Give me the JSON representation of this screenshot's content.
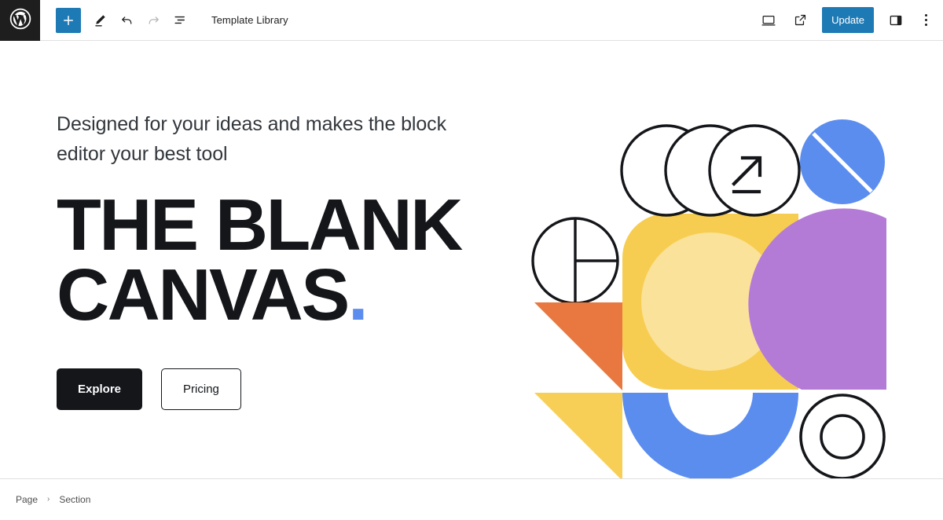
{
  "window": {
    "app": "WordPress Block Editor"
  },
  "toolbar": {
    "logo_icon": "wordpress-logo-icon",
    "add_block_label": "+",
    "add_block_icon": "plus-icon",
    "tools_icon": "pencil-edit-icon",
    "undo_icon": "undo-arrow-icon",
    "redo_icon": "redo-arrow-icon",
    "list_view_icon": "list-view-icon",
    "document_title": "Template Library",
    "preview_icon": "desktop-device-icon",
    "view_site_icon": "external-link-icon",
    "update_label": "Update",
    "settings_sidebar_icon": "sidebar-panel-icon",
    "options_icon": "kebab-vertical-dots-icon",
    "accent_color": "#1e7ab5"
  },
  "hero": {
    "subtitle": "Designed for your ideas and makes the block editor your best tool",
    "title_line1": "THE BLANK",
    "title_line2": "CANVAS",
    "title_dot": ".",
    "dot_color": "#5b8def",
    "buttons": [
      {
        "label": "Explore",
        "style": "primary"
      },
      {
        "label": "Pricing",
        "style": "secondary"
      }
    ]
  },
  "artwork": {
    "name": "abstract-geometric-collage",
    "colors": {
      "yellow": "#f7cd51",
      "yellow_light": "#fbe29a",
      "yellow_triangle": "#f8cf56",
      "orange": "#e8783f",
      "blue": "#5b8def",
      "purple": "#b47bd6",
      "outline": "#14161a"
    },
    "shapes": [
      "three-overlapping-outline-circles-with-arrow",
      "blue-circle-with-diagonal-slash",
      "quartered-outline-circle",
      "orange-triangle",
      "yellow-triangle",
      "yellow-rounded-square-with-inner-circle",
      "purple-quarter-circle",
      "blue-semicircle-donut",
      "concentric-outline-circles"
    ]
  },
  "footer": {
    "breadcrumbs": [
      {
        "label": "Page"
      },
      {
        "label": "Section"
      }
    ],
    "separator": "›"
  }
}
